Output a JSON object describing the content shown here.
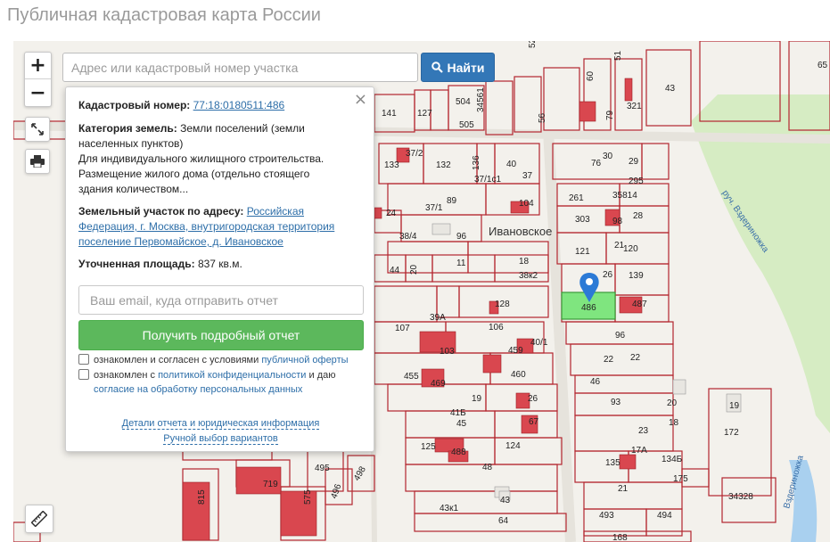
{
  "page": {
    "title": "Публичная кадастровая карта России"
  },
  "search": {
    "placeholder": "Адрес или кадастровый номер участка",
    "button_label": "Найти",
    "button_icon": "search-icon"
  },
  "controls": {
    "zoom_in": "+",
    "zoom_out": "−",
    "fullscreen_icon": "expand-icon",
    "print_icon": "printer-icon",
    "ruler_icon": "ruler-icon"
  },
  "popup": {
    "close": "×",
    "cadastral_label": "Кадастровый номер:",
    "cadastral_number": "77:18:0180511:486",
    "category_label": "Категория земель:",
    "category_value": "Земли поселений (земли населенных пунктов)",
    "usage_text": "Для индивидуального жилищного строительства. Размещение жилого дома (отдельно стоящего здания количеством...",
    "address_label": "Земельный участок по адресу:",
    "address_value": "Российская Федерация, г. Москва, внутригородская территория поселение Первомайское, д. Ивановское",
    "area_label": "Уточненная площадь:",
    "area_value": "837 кв.м.",
    "email_placeholder": "Ваш email, куда отправить отчет",
    "report_button": "Получить подробный отчет",
    "consent1_prefix": "ознакомлен и согласен с условиями",
    "consent1_link": "публичной оферты",
    "consent2_prefix": "ознакомлен с",
    "consent2_link1": "политикой конфиденциальности",
    "consent2_mid": "и даю",
    "consent2_link2": "согласие на обработку персональных данных",
    "details_link": "Детали отчета и юридическая информация",
    "manual_link": "Ручной выбор вариантов"
  },
  "map": {
    "place_name": "Ивановское",
    "river_name": "руч. Вздериножка",
    "river_name2": "Вздериножка",
    "selected_plot": "486",
    "colors": {
      "plot_border": "#b3262e",
      "selected_plot": "#7fe57f",
      "marker": "#2c7ad6",
      "forest": "#cfe8b8",
      "water": "#a9d0ef"
    },
    "plot_labels": [
      "141",
      "127",
      "504",
      "505",
      "34561",
      "56",
      "52",
      "60",
      "51",
      "43",
      "65",
      "321",
      "79",
      "133",
      "132",
      "136",
      "40",
      "76",
      "30",
      "29",
      "37/2",
      "37/1",
      "89",
      "37/1с1",
      "104",
      "37",
      "261",
      "35814",
      "295",
      "24",
      "303",
      "98",
      "28",
      "38/4",
      "96",
      "Ивановское",
      "18",
      "121",
      "21",
      "120",
      "44",
      "20",
      "11",
      "38к2",
      "26",
      "139",
      "486",
      "487",
      "107",
      "39А",
      "128",
      "106",
      "459",
      "40/1",
      "96",
      "103",
      "455",
      "469",
      "460",
      "22",
      "22",
      "46",
      "19",
      "26",
      "93",
      "41Б",
      "45",
      "67",
      "20",
      "19",
      "125",
      "488",
      "124",
      "48",
      "23",
      "18",
      "134Б",
      "135",
      "172",
      "495",
      "496",
      "498",
      "719",
      "815",
      "575",
      "34328",
      "43",
      "21",
      "175",
      "493",
      "494",
      "64",
      "43к1",
      "168"
    ]
  }
}
